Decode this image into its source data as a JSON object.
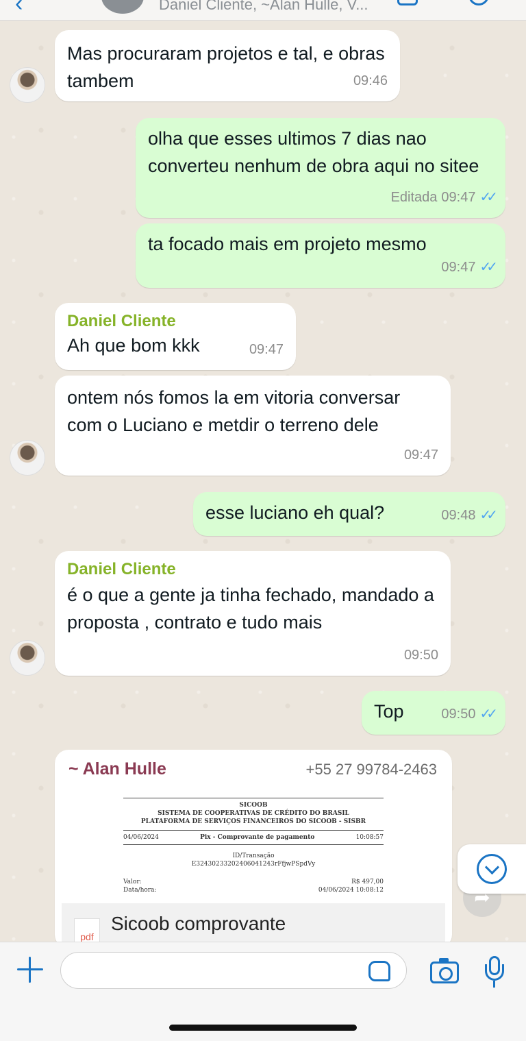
{
  "header": {
    "title": "Daniel Cliente, ~Alan Hulle, V..."
  },
  "messages": [
    {
      "dir": "in",
      "sender": "",
      "text": "Mas procuraram projetos e tal, e obras tambem",
      "time": "09:46"
    },
    {
      "dir": "out",
      "text": "olha que esses ultimos 7 dias nao converteu nenhum de obra aqui no sitee",
      "edited": "Editada",
      "time": "09:47"
    },
    {
      "dir": "out",
      "text": "ta focado mais em projeto mesmo",
      "time": "09:47"
    },
    {
      "dir": "in",
      "sender": "Daniel Cliente",
      "text": "Ah que bom kkk",
      "time": "09:47"
    },
    {
      "dir": "in",
      "sender": "",
      "text": "ontem nós fomos la em vitoria conversar com o Luciano e metdir o terreno dele",
      "time": "09:47"
    },
    {
      "dir": "out",
      "text": "esse luciano eh qual?",
      "time": "09:48"
    },
    {
      "dir": "in",
      "sender": "Daniel Cliente",
      "text": "é o que a gente ja tinha fechado, mandado a proposta , contrato e tudo mais",
      "time": "09:50"
    },
    {
      "dir": "out",
      "text": "Top",
      "time": "09:50"
    }
  ],
  "document_message": {
    "sender": "~ Alan Hulle",
    "phone": "+55 27 99784-2463",
    "preview": {
      "line1": "SICOOB",
      "line2": "SISTEMA DE COOPERATIVAS DE CRÉDITO DO BRASIL",
      "line3": "PLATAFORMA DE SERVIÇOS FINANCEIROS DO SICOOB - SISBR",
      "date": "04/06/2024",
      "doc_type": "Pix - Comprovante de pagamento",
      "time": "10:08:57",
      "id_label": "ID/Transação",
      "id_value": "E32430233202406041243rFfjwPSpdVy",
      "valor_label": "Valor:",
      "valor": "R$ 497,00",
      "datahora_label": "Data/hora:",
      "datahora": "04/06/2024 10:08:12"
    },
    "file_type": "pdf",
    "file_name": "Sicoob comprovante"
  },
  "composer": {
    "placeholder": ""
  },
  "colors": {
    "outgoing_bubble": "#d9fdd3",
    "incoming_bubble": "#ffffff",
    "sender_green": "#86b329",
    "sender_alan": "#8a3a52",
    "read_ticks": "#53a6f0",
    "accent_blue": "#1a74c4"
  },
  "icons": [
    "back-chevron-icon",
    "video-call-icon",
    "phone-icon",
    "scroll-down-icon",
    "forward-icon",
    "plus-icon",
    "sticker-icon",
    "camera-icon",
    "microphone-icon",
    "pdf-icon",
    "double-check-icon"
  ]
}
